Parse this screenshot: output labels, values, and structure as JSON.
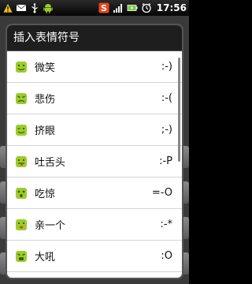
{
  "status_bar": {
    "time": "17:56",
    "left_icons": [
      "warning-icon",
      "mail-icon",
      "usb-icon",
      "android-icon"
    ],
    "right_icons": [
      "sogou-input-icon",
      "signal-icon",
      "battery-charging-icon",
      "alarm-icon"
    ]
  },
  "dialog": {
    "title": "插入表情符号",
    "items": [
      {
        "label": "微笑",
        "code": ":-)"
      },
      {
        "label": "悲伤",
        "code": ":-("
      },
      {
        "label": "挤眼",
        "code": ";-)"
      },
      {
        "label": "吐舌头",
        "code": ":-P"
      },
      {
        "label": "吃惊",
        "code": "=-O"
      },
      {
        "label": "亲一个",
        "code": ":-*"
      },
      {
        "label": "大吼",
        "code": ":O"
      }
    ]
  },
  "colors": {
    "dialog_title_bg": "#1e1e1e",
    "emoji_green": "#9ccc2a",
    "emoji_dark": "#3b5a08",
    "battery_green": "#7ac943"
  }
}
